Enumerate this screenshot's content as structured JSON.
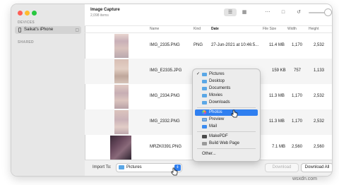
{
  "sidebar": {
    "devices_label": "DEVICES",
    "device_name": "Saikat's iPhone",
    "shared_label": "SHARED"
  },
  "header": {
    "title": "Image Capture",
    "subtitle": "2,098 items"
  },
  "columns": [
    "Name",
    "Kind",
    "Date",
    "File Size",
    "Width",
    "Height"
  ],
  "rows": [
    {
      "name": "IMG_2335.PNG",
      "kind": "PNG",
      "date": "27-Jun-2021 at 10:46:5...",
      "size": "11.4 MB",
      "width": "1,170",
      "height": "2,532"
    },
    {
      "name": "IMG_E2335.JPG",
      "kind": "",
      "date": "",
      "size": "159 KB",
      "width": "757",
      "height": "1,133"
    },
    {
      "name": "IMG_2334.PNG",
      "kind": "",
      "date": "",
      "size": "11.3 MB",
      "width": "1,170",
      "height": "2,532"
    },
    {
      "name": "IMG_2332.PNG",
      "kind": "",
      "date": "",
      "size": "11.3 MB",
      "width": "1,170",
      "height": "2,532"
    },
    {
      "name": "MRZK0391.PNG",
      "kind": "",
      "date": "",
      "size": "7.1 MB",
      "width": "2,560",
      "height": "2,560"
    }
  ],
  "menu": {
    "items": [
      {
        "label": "Pictures",
        "icon": "folder-icon",
        "checked": true
      },
      {
        "label": "Desktop",
        "icon": "folder-icon"
      },
      {
        "label": "Documents",
        "icon": "folder-icon"
      },
      {
        "label": "Movies",
        "icon": "folder-icon"
      },
      {
        "label": "Downloads",
        "icon": "folder-icon"
      },
      {
        "label": "Photos",
        "icon": "photos-icon",
        "selected": true
      },
      {
        "label": "Preview",
        "icon": "preview-icon"
      },
      {
        "label": "Mail",
        "icon": "mail-icon"
      },
      {
        "label": "MakePDF",
        "icon": "makepdf-icon"
      },
      {
        "label": "Build Web Page",
        "icon": "web-page-icon"
      },
      {
        "label": "Other..."
      }
    ]
  },
  "bottom": {
    "import_label": "Import To:",
    "import_value": "Pictures",
    "download_label": "Download",
    "download_all_label": "Download All"
  },
  "watermark": "wsxdn.com",
  "colors": {
    "accent": "#2f7ff0",
    "close": "#fe5f57",
    "minimize": "#febc2e",
    "zoom": "#28c840",
    "sidebar_bg": "#e7e7e7"
  }
}
